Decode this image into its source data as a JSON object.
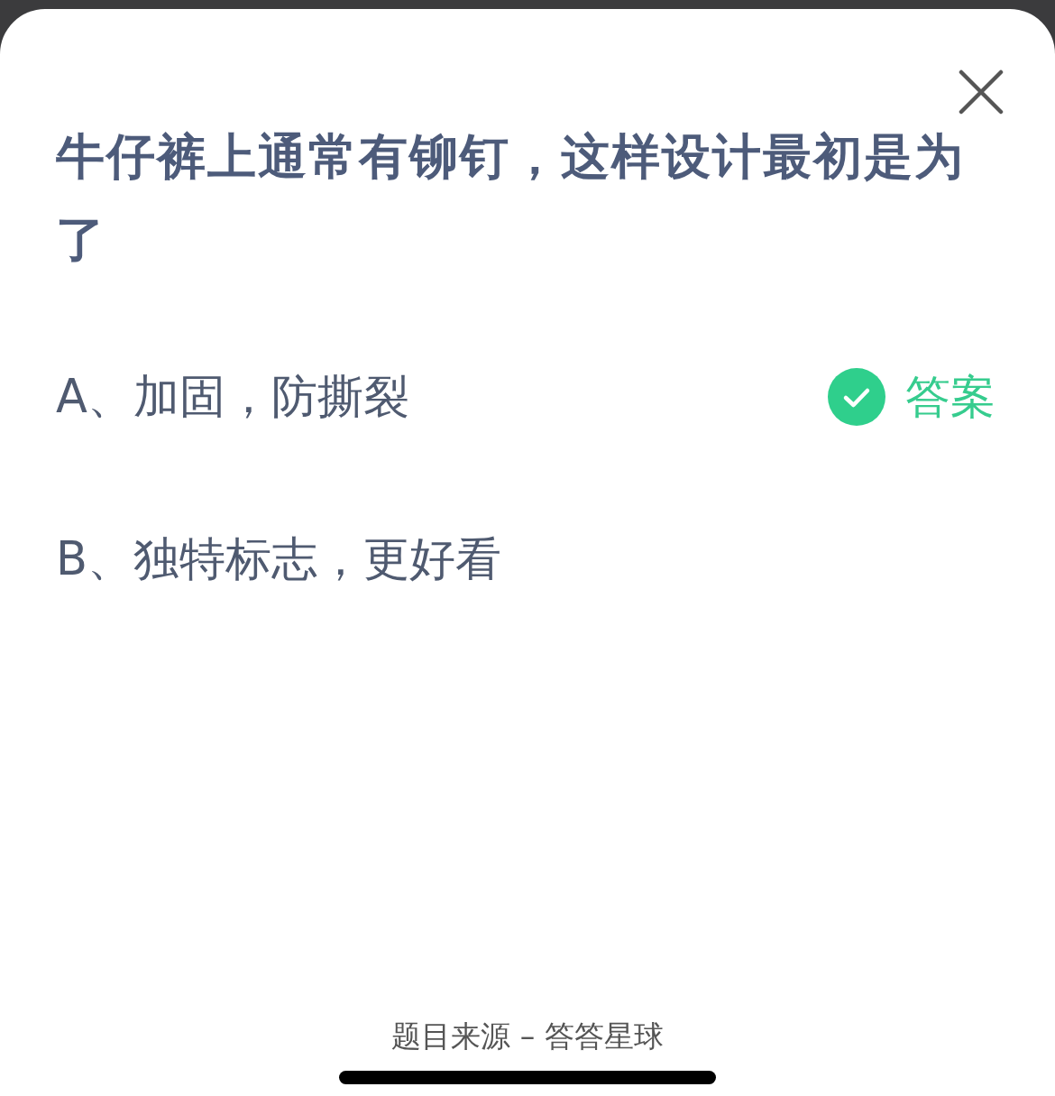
{
  "question": "牛仔裤上通常有铆钉，这样设计最初是为了",
  "options": [
    {
      "text": "A、加固，防撕裂",
      "selected": true
    },
    {
      "text": "B、独特标志，更好看",
      "selected": false
    }
  ],
  "answer_label": "答案",
  "footer": "题目来源 – 答答星球"
}
